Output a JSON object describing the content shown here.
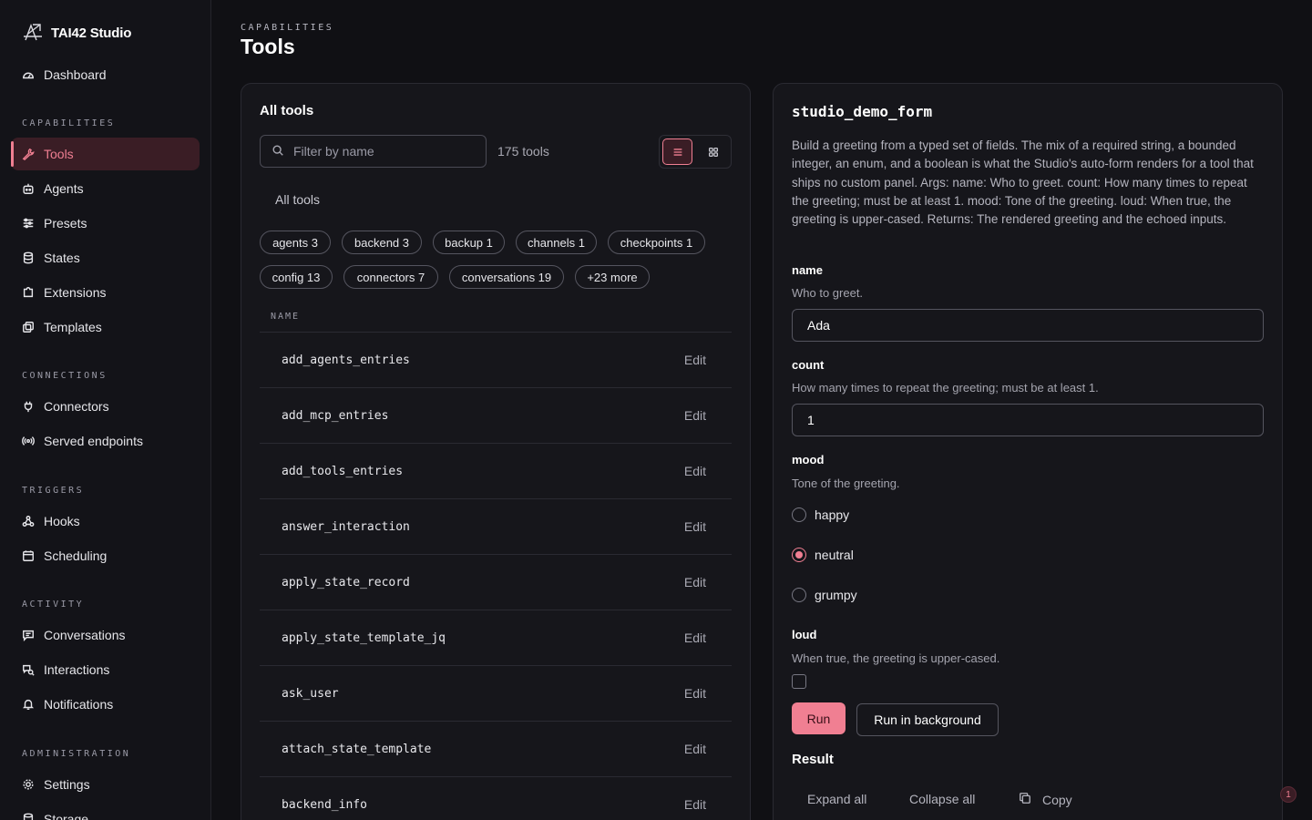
{
  "brand": {
    "name": "TAI42 Studio"
  },
  "sidebar": {
    "dashboard": "Dashboard",
    "sections": {
      "capabilities": "CAPABILITIES",
      "connections": "CONNECTIONS",
      "triggers": "TRIGGERS",
      "activity": "ACTIVITY",
      "administration": "ADMINISTRATION"
    },
    "items": {
      "tools": "Tools",
      "agents": "Agents",
      "presets": "Presets",
      "states": "States",
      "extensions": "Extensions",
      "templates": "Templates",
      "connectors": "Connectors",
      "served_endpoints": "Served endpoints",
      "hooks": "Hooks",
      "scheduling": "Scheduling",
      "conversations": "Conversations",
      "interactions": "Interactions",
      "notifications": "Notifications",
      "settings": "Settings",
      "storage": "Storage"
    }
  },
  "header": {
    "kicker": "CAPABILITIES",
    "title": "Tools"
  },
  "tools_panel": {
    "title": "All tools",
    "filter_placeholder": "Filter by name",
    "count_label": "175 tools",
    "tab_label": "All tools",
    "chips": [
      "agents 3",
      "backend 3",
      "backup 1",
      "channels 1",
      "checkpoints 1",
      "config 13",
      "connectors 7",
      "conversations 19",
      "+23 more"
    ],
    "column_name": "NAME",
    "edit_label": "Edit",
    "rows": [
      "add_agents_entries",
      "add_mcp_entries",
      "add_tools_entries",
      "answer_interaction",
      "apply_state_record",
      "apply_state_template_jq",
      "ask_user",
      "attach_state_template",
      "backend_info"
    ]
  },
  "form": {
    "title": "studio_demo_form",
    "description": "Build a greeting from a typed set of fields. The mix of a required string, a bounded integer, an enum, and a boolean is what the Studio's auto-form renders for a tool that ships no custom panel. Args: name: Who to greet. count: How many times to repeat the greeting; must be at least 1. mood: Tone of the greeting. loud: When true, the greeting is upper-cased. Returns: The rendered greeting and the echoed inputs.",
    "name_label": "name",
    "name_help": "Who to greet.",
    "name_value": "Ada",
    "count_label": "count",
    "count_help": "How many times to repeat the greeting; must be at least 1.",
    "count_value": "1",
    "mood_label": "mood",
    "mood_help": "Tone of the greeting.",
    "mood_options": [
      "happy",
      "neutral",
      "grumpy"
    ],
    "mood_selected": "neutral",
    "loud_label": "loud",
    "loud_help": "When true, the greeting is upper-cased.",
    "run_label": "Run",
    "run_bg_label": "Run in background",
    "result_title": "Result",
    "expand_all": "Expand all",
    "collapse_all": "Collapse all",
    "copy": "Copy"
  },
  "notification_badge": "1",
  "colors": {
    "accent": "#f07f92",
    "background": "#101014",
    "panel": "#16161b"
  }
}
